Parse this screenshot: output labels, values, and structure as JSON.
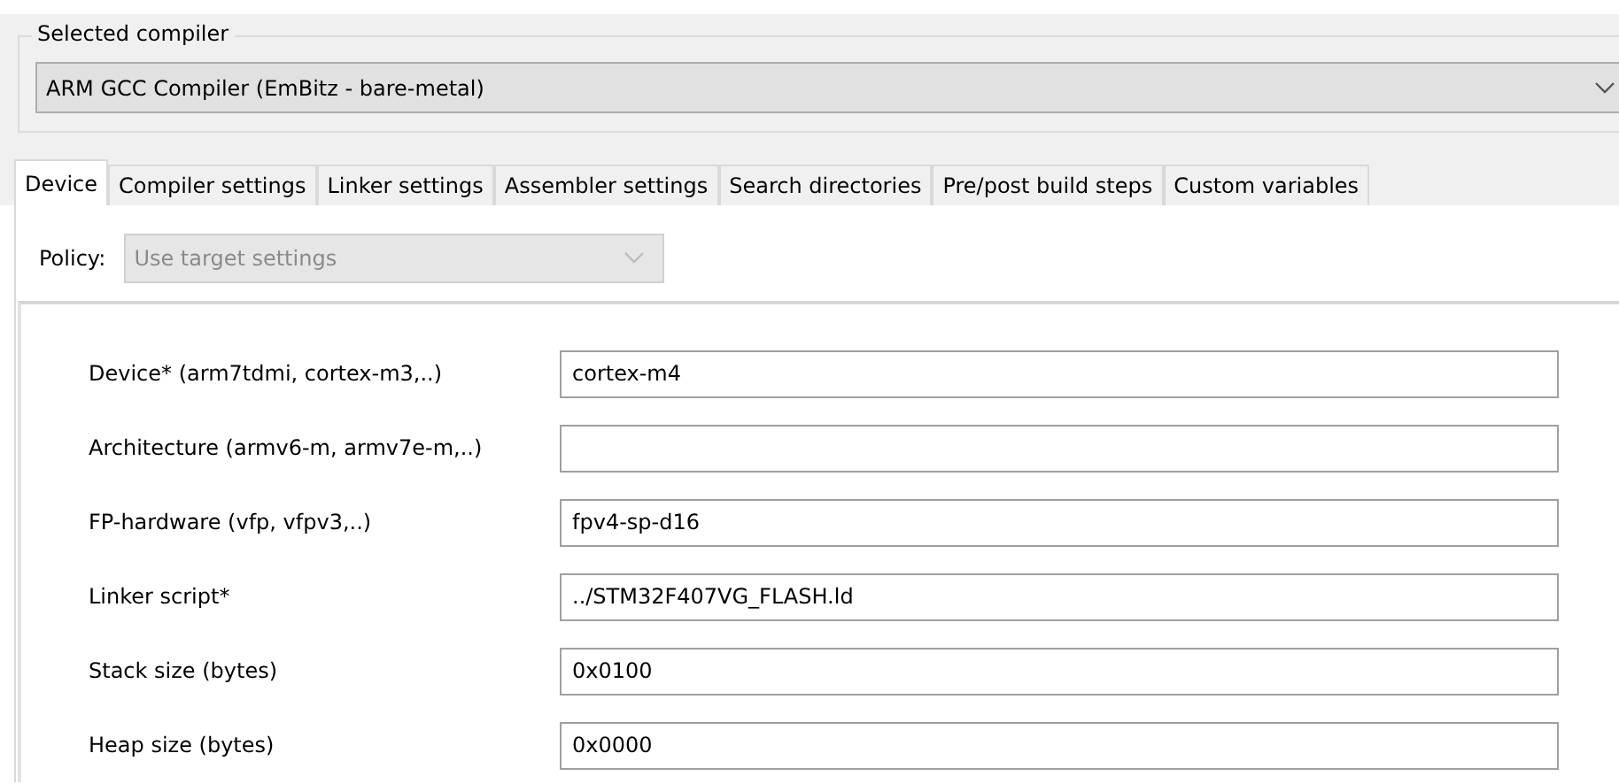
{
  "compiler_group": {
    "title": "Selected compiler",
    "selection": "ARM GCC Compiler (EmBitz - bare-metal)"
  },
  "tabs": [
    {
      "label": "Device",
      "selected": true
    },
    {
      "label": "Compiler settings",
      "selected": false
    },
    {
      "label": "Linker settings",
      "selected": false
    },
    {
      "label": "Assembler settings",
      "selected": false
    },
    {
      "label": "Search directories",
      "selected": false
    },
    {
      "label": "Pre/post build steps",
      "selected": false
    },
    {
      "label": "Custom variables",
      "selected": false
    }
  ],
  "policy": {
    "label": "Policy:",
    "value": "Use target settings",
    "disabled": true
  },
  "fields": [
    {
      "label": "Device* (arm7tdmi, cortex-m3,..)",
      "value": "cortex-m4"
    },
    {
      "label": "Architecture (armv6-m, armv7e-m,..)"
    },
    {
      "label": "FP-hardware (vfp, vfpv3,..)",
      "value": "fpv4-sp-d16"
    },
    {
      "label": "Linker script*",
      "value": "../STM32F407VG_FLASH.ld"
    },
    {
      "label": "Stack size (bytes)",
      "value": "0x0100"
    },
    {
      "label": "Heap size (bytes)",
      "value": "0x0000"
    }
  ]
}
